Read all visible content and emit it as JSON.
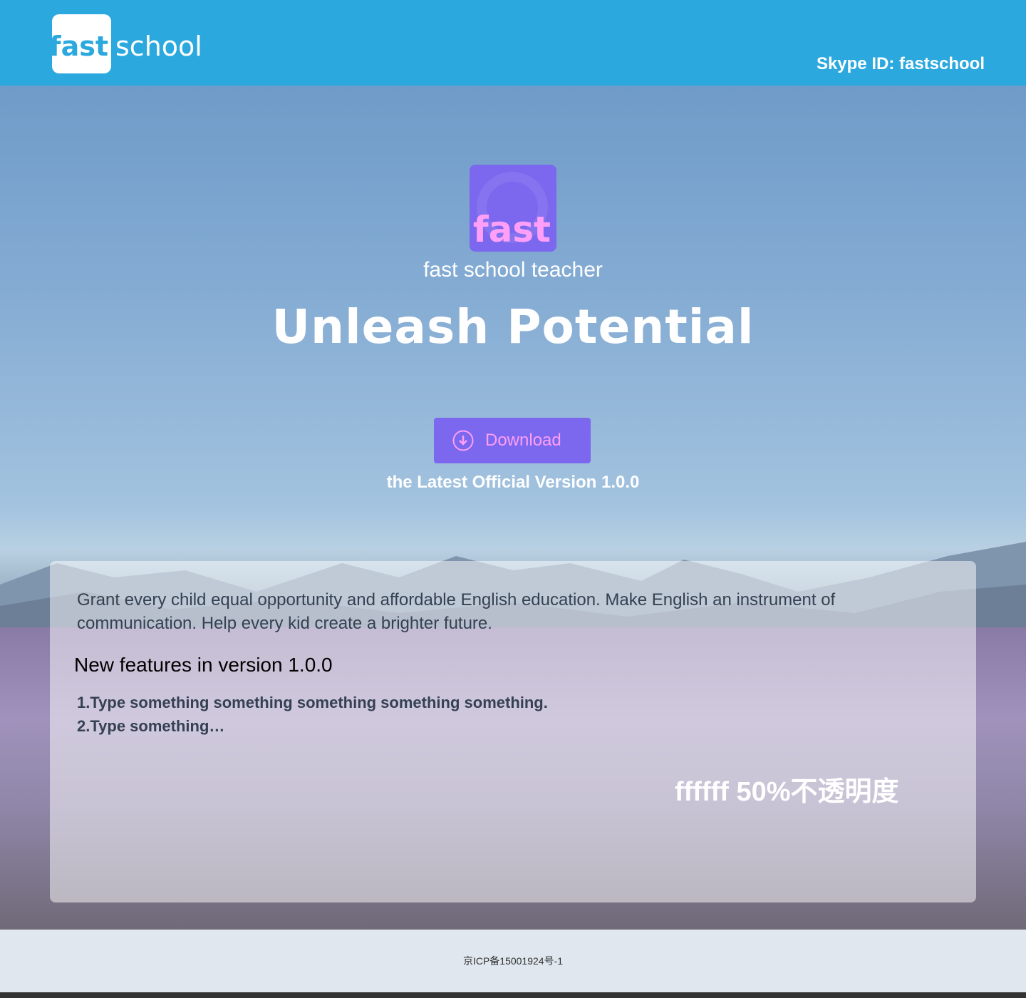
{
  "header": {
    "logo_fast": "fast",
    "logo_school": "school",
    "skype": "Skype ID: fastschool",
    "bg_color": "#2ba8de"
  },
  "hero": {
    "app_icon_text": "fast",
    "app_name": "fast school teacher",
    "slogan": "Unleash  Potential",
    "download_label": "Download",
    "download_icon": "download-circle-icon",
    "version_text": "the Latest Official Version 1.0.0",
    "accent_color": "#7b68ee"
  },
  "panel": {
    "mission": "Grant every child equal opportunity and affordable English education. Make English an instrument of communication. Help every kid create a brighter future.",
    "features_title": "New features in version 1.0.0",
    "features": [
      "1.Type something something something something something.",
      "2.Type something…"
    ],
    "note": "ffffff  50%不透明度"
  },
  "footer": {
    "icp": "京ICP备15001924号-1",
    "bg_color": "#e0e7ef"
  }
}
